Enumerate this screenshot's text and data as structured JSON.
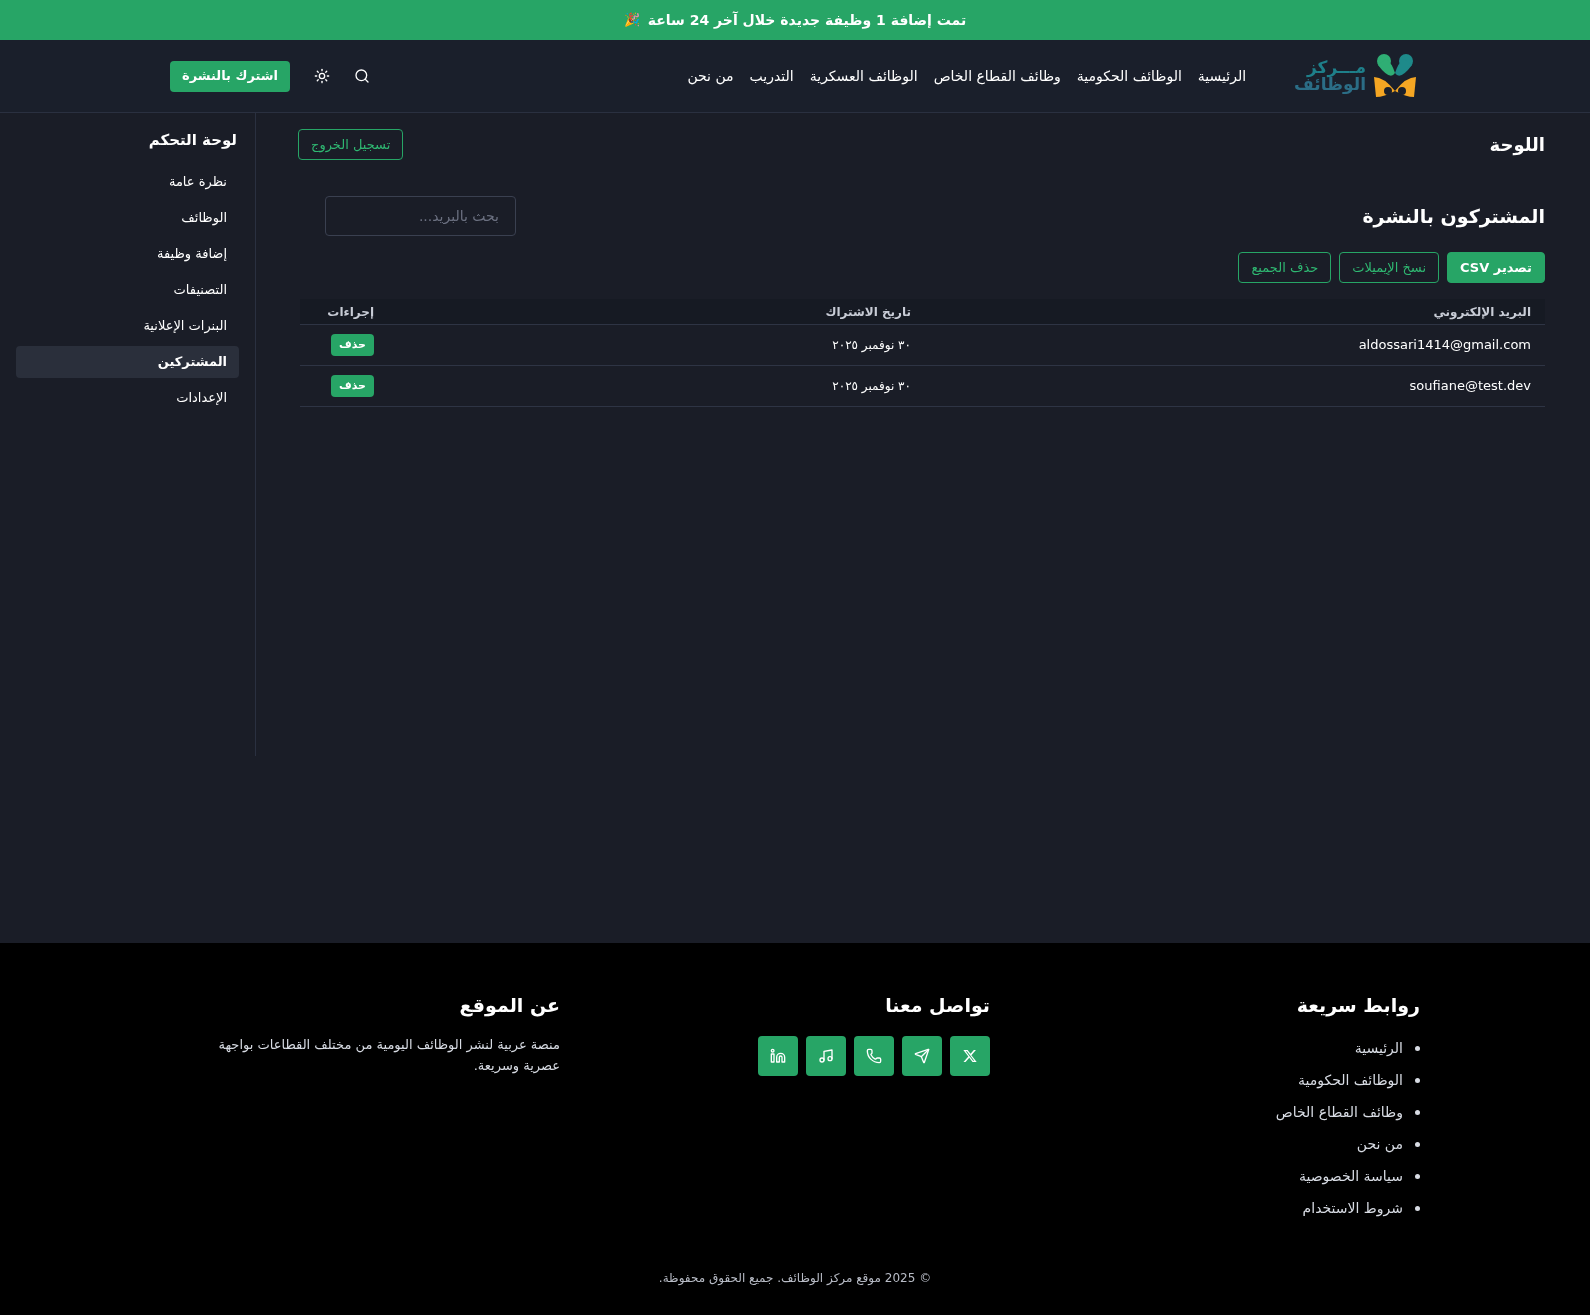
{
  "announcement": {
    "text": "تمت إضافة 1 وظيفة جديدة خلال آخر 24 ساعة",
    "emoji": "🎉"
  },
  "header": {
    "logo": {
      "line_1": "مـــركز",
      "line_2": "الوظائف"
    },
    "nav": [
      "الرئيسية",
      "الوظائف الحكومية",
      "وظائف القطاع الخاص",
      "الوظائف العسكرية",
      "التدريب",
      "من نحن"
    ],
    "subscribe_button": "اشترك بالنشرة"
  },
  "sidebar": {
    "title": "لوحة التحكم",
    "items": [
      {
        "label": "نظرة عامة",
        "selected": false
      },
      {
        "label": "الوظائف",
        "selected": false
      },
      {
        "label": "إضافة وظيفة",
        "selected": false
      },
      {
        "label": "التصنيفات",
        "selected": false
      },
      {
        "label": "البنرات الإعلانية",
        "selected": false
      },
      {
        "label": "المشتركين",
        "selected": true
      },
      {
        "label": "الإعدادات",
        "selected": false
      }
    ]
  },
  "main": {
    "title": "اللوحة",
    "logout_button": "تسجيل الخروج",
    "section_title": "المشتركون بالنشرة",
    "search": {
      "placeholder": "بحث بالبريد..."
    },
    "actions": [
      {
        "label": "تصدير CSV",
        "kind": "primary"
      },
      {
        "label": "نسخ الإيميلات",
        "kind": "outline"
      },
      {
        "label": "حذف الجميع",
        "kind": "outline"
      }
    ],
    "table": {
      "columns": [
        "البريد الإلكتروني",
        "تاريخ الاشتراك",
        "إجراءات"
      ],
      "rows": [
        {
          "email": "aldossari1414@gmail.com",
          "date": "٣٠ نوفمبر ٢٠٢٥",
          "action": "حذف"
        },
        {
          "email": "soufiane@test.dev",
          "date": "٣٠ نوفمبر ٢٠٢٥",
          "action": "حذف"
        }
      ]
    }
  },
  "footer": {
    "quick_links": {
      "title": "روابط سريعة",
      "items": [
        "الرئيسية",
        "الوظائف الحكومية",
        "وظائف القطاع الخاص",
        "من نحن",
        "سياسة الخصوصية",
        "شروط الاستخدام"
      ]
    },
    "contact": {
      "title": "تواصل معنا",
      "icons": [
        {
          "kind": "x"
        },
        {
          "kind": "telegram"
        },
        {
          "kind": "phone"
        },
        {
          "kind": "tiktok"
        },
        {
          "kind": "linkedin"
        }
      ]
    },
    "about": {
      "title": "عن الموقع",
      "text": "منصة عربية لنشر الوظائف اليومية من مختلف القطاعات بواجهة عصرية وسريعة."
    },
    "copyright": "© 2025 موقع مركز الوظائف. جميع الحقوق محفوظة."
  }
}
